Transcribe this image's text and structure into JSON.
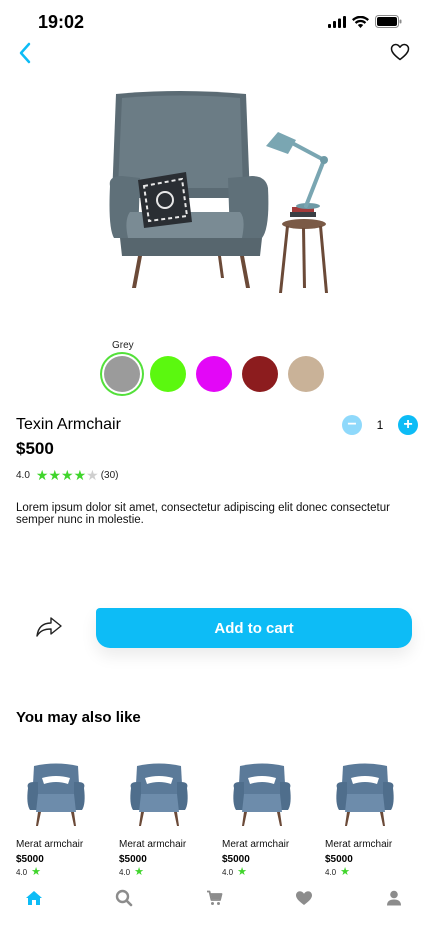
{
  "status_bar": {
    "time": "19:02"
  },
  "product": {
    "color_label": "Grey",
    "swatches": [
      {
        "name": "grey",
        "color": "#9b9b9b",
        "selected": true
      },
      {
        "name": "green",
        "color": "#5bf80f",
        "selected": false
      },
      {
        "name": "magenta",
        "color": "#e307f7",
        "selected": false
      },
      {
        "name": "maroon",
        "color": "#8c1c1e",
        "selected": false
      },
      {
        "name": "tan",
        "color": "#c9b298",
        "selected": false
      }
    ],
    "name": "Texin Armchair",
    "price": "$500",
    "quantity": "1",
    "qty_minus": "−",
    "qty_plus": "+",
    "rating_value": "4.0",
    "rating_stars": 4,
    "rating_count": "(30)",
    "description": "Lorem ipsum dolor sit amet, consectetur adipiscing elit donec consectetur semper nunc in molestie."
  },
  "actions": {
    "add_to_cart": "Add to cart"
  },
  "recommendations": {
    "title": "You may also like",
    "items": [
      {
        "name": "Merat armchair",
        "price": "$5000",
        "rating": "4.0"
      },
      {
        "name": "Merat armchair",
        "price": "$5000",
        "rating": "4.0"
      },
      {
        "name": "Merat armchair",
        "price": "$5000",
        "rating": "4.0"
      },
      {
        "name": "Merat armchair",
        "price": "$5000",
        "rating": "4.0"
      }
    ]
  },
  "colors": {
    "accent": "#0dbcf6",
    "star": "#40d52c",
    "nav_active": "#0dbcf6",
    "nav_inactive": "#8c8c8c"
  },
  "icons": [
    "back-arrow-icon",
    "heart-icon",
    "share-icon",
    "home-icon",
    "search-icon",
    "cart-icon",
    "favorites-icon",
    "profile-icon"
  ]
}
